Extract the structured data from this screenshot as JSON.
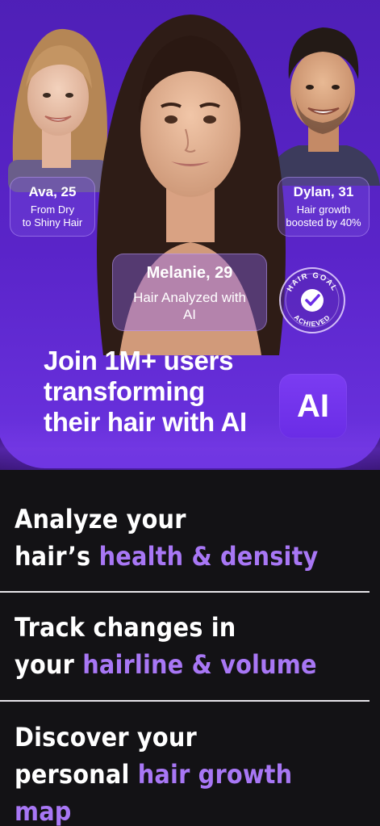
{
  "hero": {
    "testimonials": [
      {
        "name": "Ava, 25",
        "line1": "From Dry",
        "line2": "to Shiny Hair"
      },
      {
        "name": "Dylan, 31",
        "line1": "Hair growth",
        "line2": "boosted by 40%"
      },
      {
        "name": "Melanie, 29",
        "line1": "Hair Analyzed with",
        "line2": "AI"
      }
    ],
    "seal": {
      "top_text": "HAIR GOAL",
      "bottom_text": "ACHIEVED",
      "icon": "checkmark-icon"
    },
    "headline": [
      "Join 1M+ users",
      "transforming",
      "their hair with AI"
    ],
    "ai_chip": "AI"
  },
  "features": [
    {
      "line1": "Analyze your",
      "line2_plain": "hair’s ",
      "line2_highlight": "health & density"
    },
    {
      "line1": "Track changes in",
      "line2_plain": "your ",
      "line2_highlight": "hairline & volume"
    },
    {
      "line1": "Discover your",
      "line2_plain": "personal ",
      "line2_highlight": "hair growth map"
    }
  ],
  "colors": {
    "background": "#131215",
    "hero_purple": "#5a24c9",
    "highlight": "#a877f5",
    "text": "#ffffff"
  }
}
